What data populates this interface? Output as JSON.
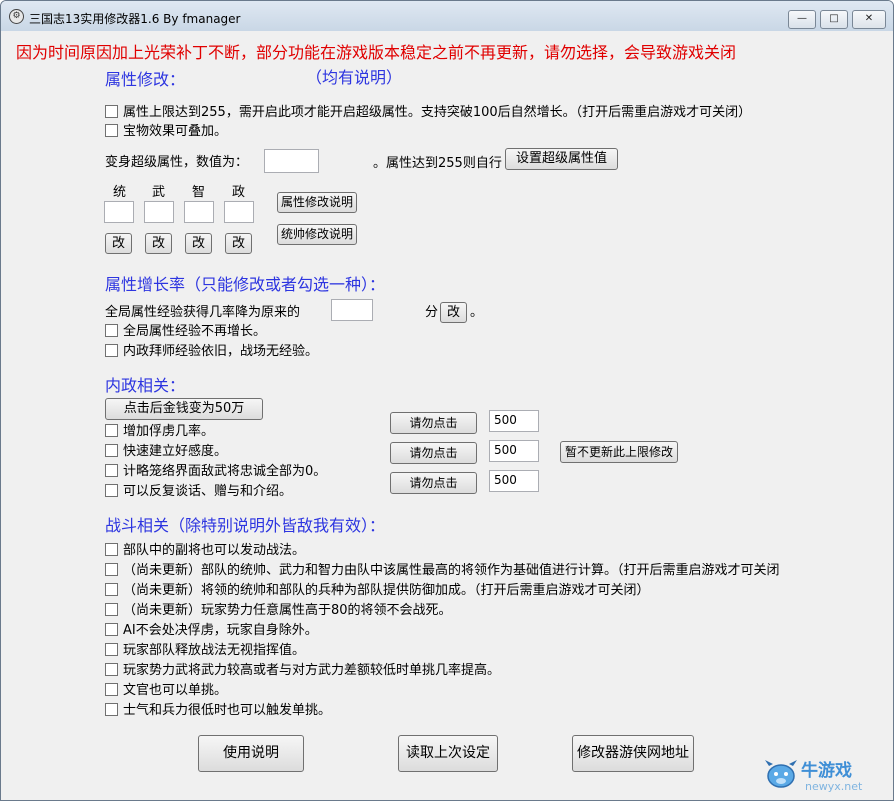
{
  "window": {
    "title": "三国志13实用修改器1.6 By fmanager",
    "minimize_glyph": "—",
    "maximize_glyph": "□",
    "close_glyph": "✕"
  },
  "warning": "因为时间原因加上光荣补丁不断，部分功能在游戏版本稳定之前不再更新，请勿选择，会导致游戏关闭",
  "attr": {
    "heading": "属性修改：",
    "note": "（均有说明）",
    "cb_limit": "属性上限达到255，需开启此项才能开启超级属性。支持突破100后自然增长。（打开后需重启游戏才可关闭）",
    "cb_treasure": "宝物效果可叠加。",
    "super_label": "变身超级属性，数值为：",
    "super_value": "",
    "super_suffix": "。属性达到255则自行",
    "super_button": "设置超级属性值",
    "stats": [
      "统",
      "武",
      "智",
      "政"
    ],
    "stat_values": [
      "",
      "",
      "",
      ""
    ],
    "change_label": "改",
    "explain_attr_button": "属性修改说明",
    "explain_lead_button": "统帅修改说明"
  },
  "growth": {
    "heading": "属性增长率（只能修改或者勾选一种）：",
    "exp_label": "全局属性经验获得几率降为原来的",
    "exp_value": "",
    "exp_unit": "分",
    "change_label": "改",
    "exp_suffix": "。",
    "cb_no_growth": "全局属性经验不再增长。",
    "cb_mentor": "内政拜师经验依旧，战场无经验。"
  },
  "domestic": {
    "heading": "内政相关：",
    "gold_button": "点击后金钱变为50万",
    "cb_capture": "增加俘虏几率。",
    "cb_friend": "快速建立好感度。",
    "cb_loyalty": "计略笼络界面敌武将忠诚全部为0。",
    "cb_talk": "可以反复谈话、赠与和介绍。",
    "no_click_buttons": [
      "请勿点击",
      "请勿点击",
      "请勿点击"
    ],
    "values": [
      "500",
      "500",
      "500"
    ],
    "limit_button": "暂不更新此上限修改"
  },
  "battle": {
    "heading": "战斗相关（除特别说明外皆敌我有效）：",
    "items": [
      "部队中的副将也可以发动战法。",
      "（尚未更新）部队的统帅、武力和智力由队中该属性最高的将领作为基础值进行计算。（打开后需重启游戏才可关闭",
      "（尚未更新）将领的统帅和部队的兵种为部队提供防御加成。（打开后需重启游戏才可关闭）",
      "（尚未更新）玩家势力任意属性高于80的将领不会战死。",
      "AI不会处决俘虏，玩家自身除外。",
      "玩家部队释放战法无视指挥值。",
      "玩家势力武将武力较高或者与对方武力差额较低时单挑几率提高。",
      "文官也可以单挑。",
      "士气和兵力很低时也可以触发单挑。"
    ]
  },
  "footer": {
    "help_button": "使用说明",
    "load_button": "读取上次设定",
    "site_button": "修改器游侠网地址"
  },
  "watermark": {
    "brand": "牛游戏",
    "domain": "newyx.net"
  }
}
